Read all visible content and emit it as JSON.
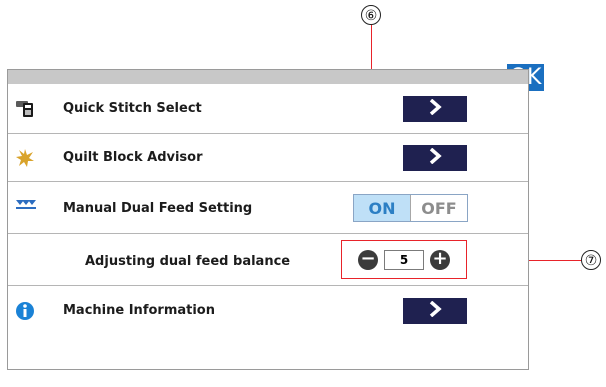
{
  "ok_label": "OK",
  "rows": {
    "quick_stitch": {
      "label": "Quick Stitch Select",
      "icon": "phone-icon"
    },
    "quilt_block": {
      "label": "Quilt Block Advisor",
      "icon": "star-icon"
    },
    "dual_feed": {
      "label": "Manual Dual Feed Setting",
      "icon": "dual-feed-icon",
      "toggle_on": "ON",
      "toggle_off": "OFF",
      "selected": "ON"
    },
    "adjust_balance": {
      "label": "Adjusting dual feed balance",
      "value": "5",
      "minus": "−",
      "plus": "+"
    },
    "machine_info": {
      "label": "Machine Information",
      "icon": "info-icon"
    }
  },
  "callouts": {
    "on_toggle": "⑥",
    "stepper": "⑦"
  },
  "colors": {
    "accent": "#1a6fc0",
    "arrow_button": "#1f2150",
    "toggle_on_bg": "#bfe0f7",
    "callout": "#e8232a"
  }
}
